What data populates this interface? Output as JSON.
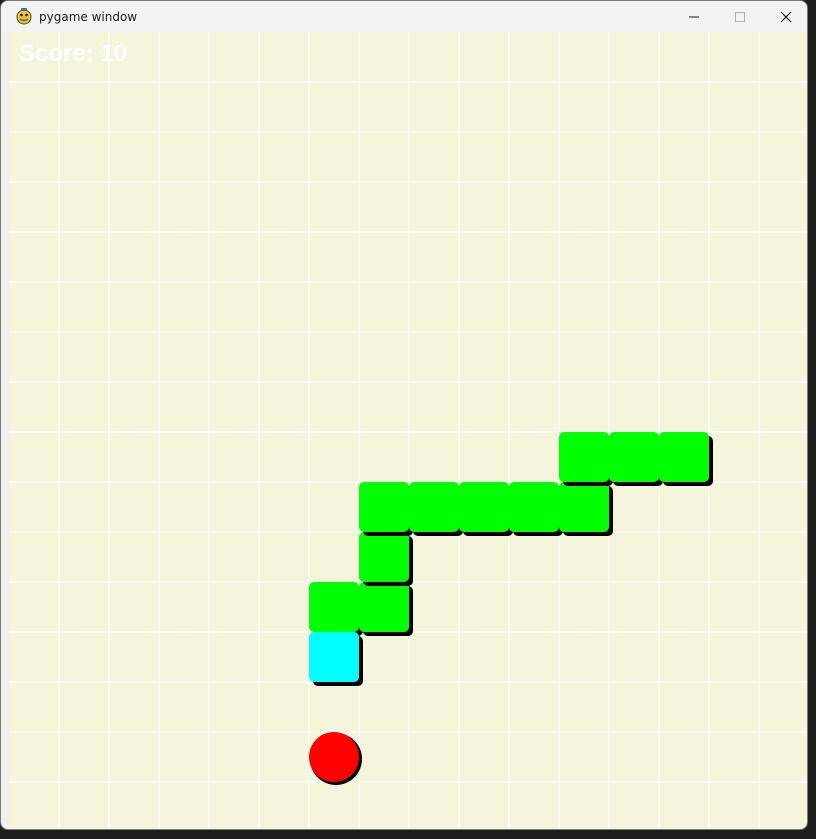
{
  "window": {
    "title": "pygame window",
    "app_icon": "pygame-snake-icon"
  },
  "controls": {
    "minimize_icon": "minimize-icon",
    "maximize_icon": "maximize-icon",
    "close_icon": "close-icon"
  },
  "game": {
    "score_label": "Score: 10",
    "grid_columns": 16,
    "grid_rows": 16,
    "colors": {
      "background": "#f5f5dc",
      "grid_line": "#ffffff",
      "snake_body": "#00ff00",
      "snake_head": "#00ffff",
      "food": "#ff0000",
      "shadow": "#000000",
      "score_text": "#ffffff"
    },
    "snake": {
      "head": [
        6,
        12
      ],
      "body": [
        [
          6,
          11
        ],
        [
          7,
          11
        ],
        [
          7,
          10
        ],
        [
          7,
          9
        ],
        [
          8,
          9
        ],
        [
          9,
          9
        ],
        [
          10,
          9
        ],
        [
          11,
          9
        ],
        [
          11,
          8
        ],
        [
          12,
          8
        ],
        [
          13,
          8
        ]
      ]
    },
    "food": [
      6,
      14
    ]
  }
}
